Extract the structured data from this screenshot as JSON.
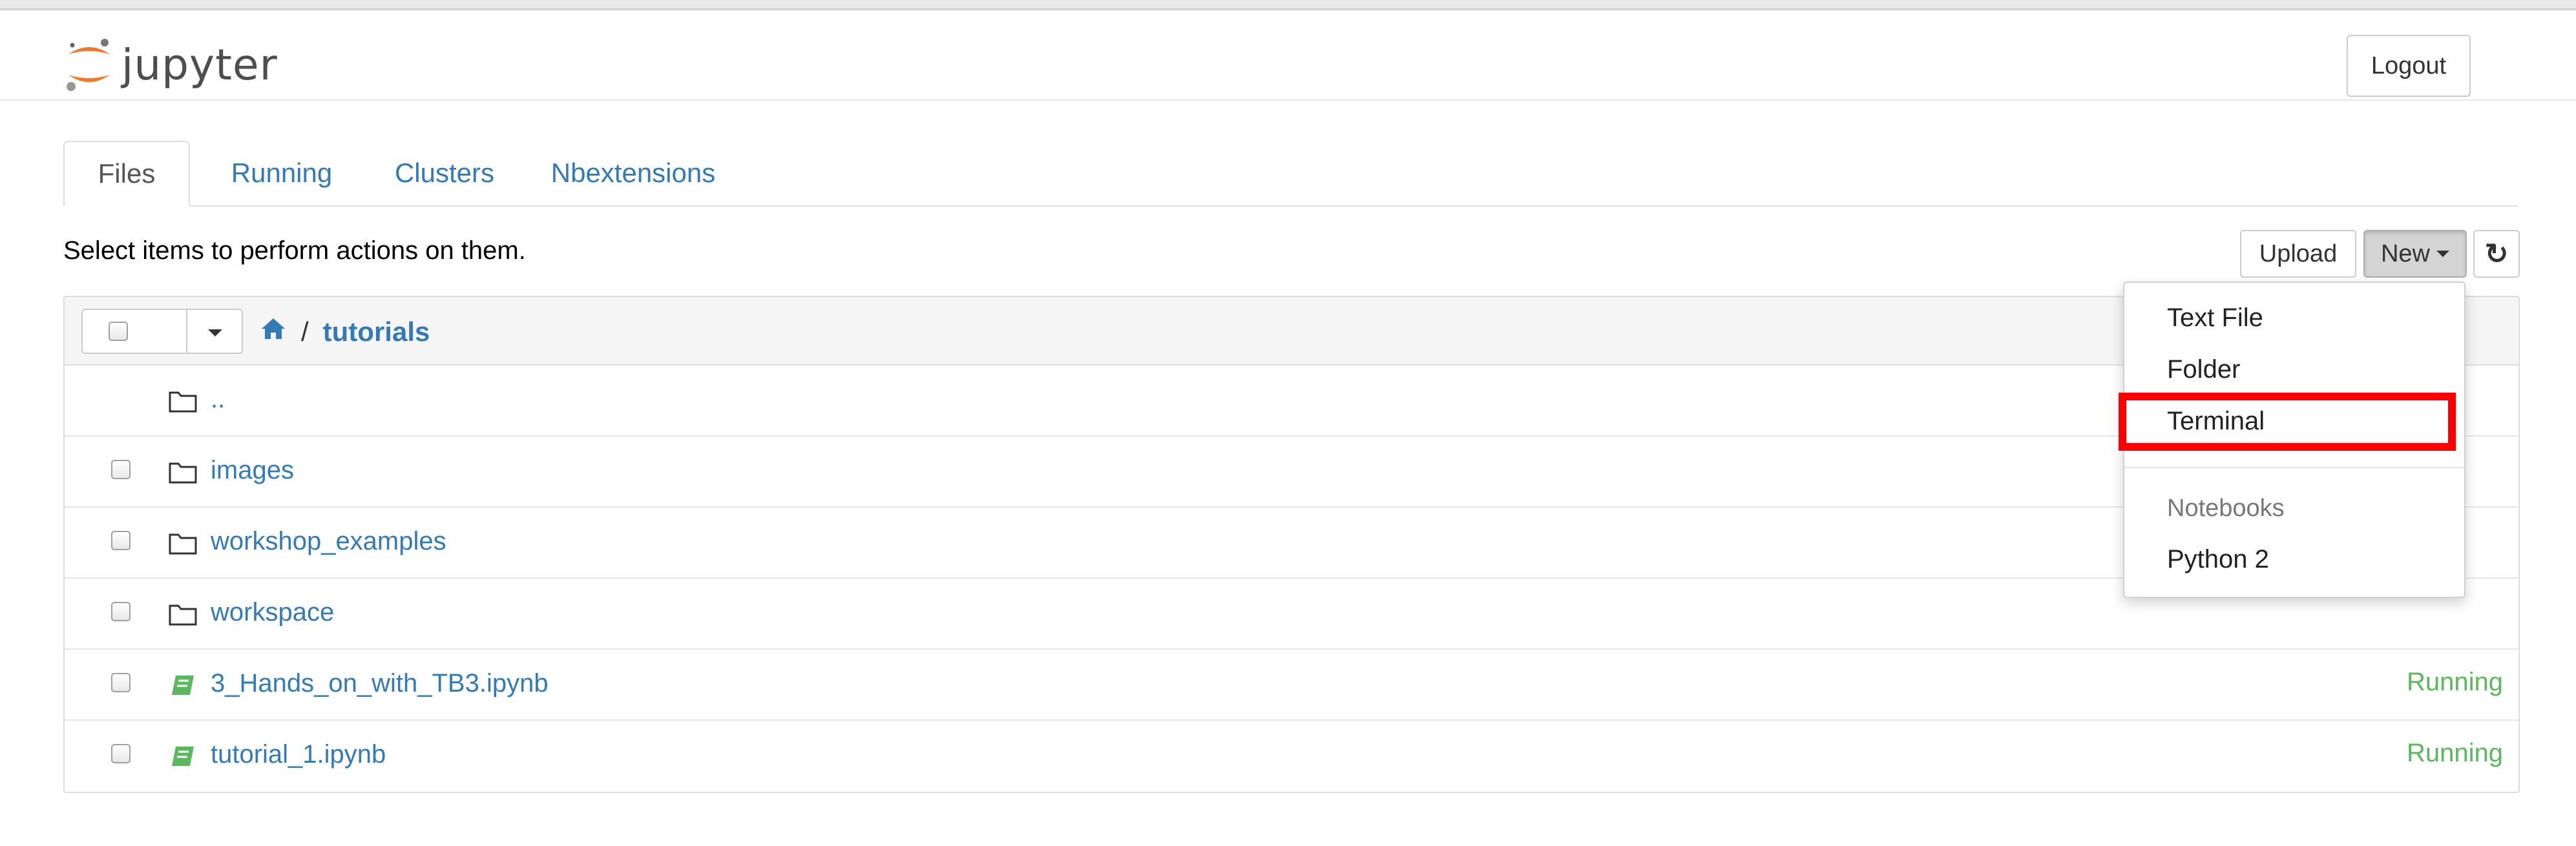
{
  "header": {
    "app_name": "jupyter",
    "logout_label": "Logout"
  },
  "tabs": [
    {
      "label": "Files",
      "active": true
    },
    {
      "label": "Running",
      "active": false
    },
    {
      "label": "Clusters",
      "active": false
    },
    {
      "label": "Nbextensions",
      "active": false
    }
  ],
  "toolbar": {
    "instructions": "Select items to perform actions on them.",
    "upload_label": "Upload",
    "new_label": "New",
    "refresh_icon": "refresh-icon"
  },
  "breadcrumb": {
    "home_icon": "home-icon",
    "separator": "/",
    "current": "tutorials"
  },
  "files": [
    {
      "name": "..",
      "type": "folder",
      "status": ""
    },
    {
      "name": "images",
      "type": "folder",
      "status": ""
    },
    {
      "name": "workshop_examples",
      "type": "folder",
      "status": ""
    },
    {
      "name": "workspace",
      "type": "folder",
      "status": ""
    },
    {
      "name": "3_Hands_on_with_TB3.ipynb",
      "type": "notebook",
      "status": "Running"
    },
    {
      "name": "tutorial_1.ipynb",
      "type": "notebook",
      "status": "Running"
    }
  ],
  "new_menu": {
    "items": [
      "Text File",
      "Folder",
      "Terminal"
    ],
    "notebooks_header": "Notebooks",
    "kernels": [
      "Python 2"
    ],
    "highlighted": "Terminal"
  },
  "colors": {
    "link": "#337ab7",
    "running": "#5cb85c",
    "highlight": "#ff0000",
    "logo_orange": "#f37726"
  }
}
